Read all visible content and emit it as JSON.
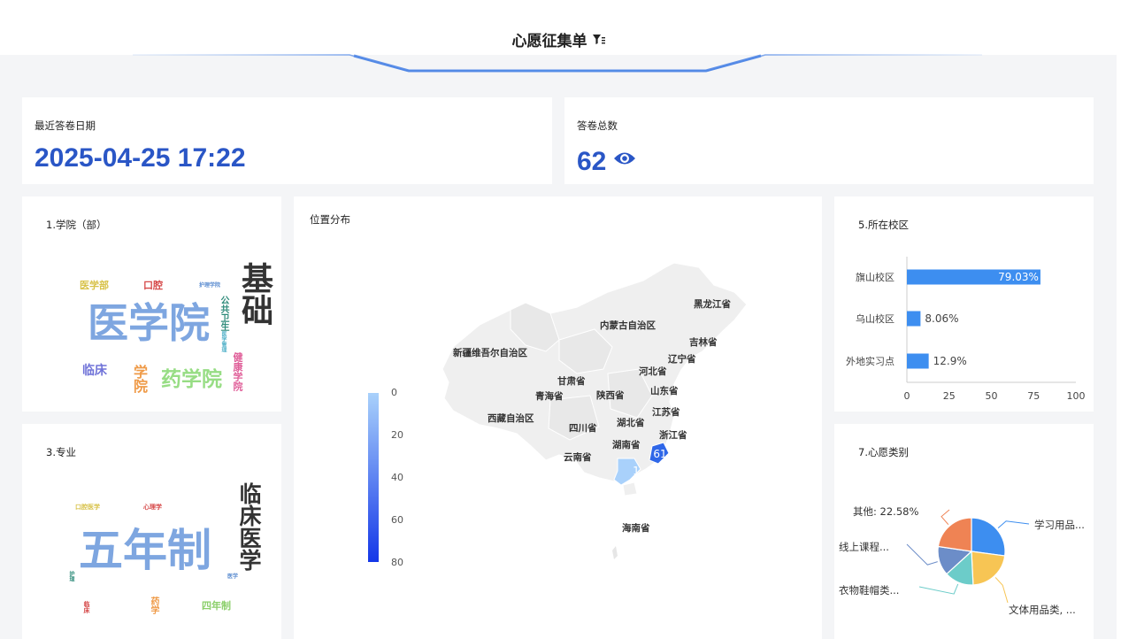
{
  "header": {
    "title": "心愿征集单"
  },
  "kpi_date": {
    "label": "最近答卷日期",
    "value": "2025-04-25 17:22"
  },
  "kpi_count": {
    "label": "答卷总数",
    "value": "62"
  },
  "college": {
    "title": "1.学院（部）",
    "words": [
      "基础",
      "医学院",
      "药学院",
      "学院",
      "临床",
      "医学部",
      "口腔",
      "公共卫生",
      "健康学院",
      "护理学院",
      "医学管理"
    ]
  },
  "major": {
    "title": "3.专业",
    "words": [
      "五年制",
      "临床医学",
      "四年制",
      "药学",
      "临床",
      "口腔医学",
      "心理学",
      "医学",
      "护理"
    ]
  },
  "map": {
    "title": "位置分布",
    "provinces": [
      "黑龙江省",
      "内蒙古自治区",
      "吉林省",
      "新疆维吾尔自治区",
      "辽宁省",
      "甘肃省",
      "河北省",
      "青海省",
      "陕西省",
      "山东省",
      "江苏省",
      "西藏自治区",
      "湖北省",
      "四川省",
      "浙江省",
      "湖南省",
      "云南省",
      "海南省"
    ],
    "values": {
      "guangdong": "1",
      "fujian": "61"
    },
    "legend_ticks": [
      "0",
      "20",
      "40",
      "60",
      "80"
    ]
  },
  "campus": {
    "title": "5.所在校区"
  },
  "wish": {
    "title": "7.心愿类别",
    "labels": [
      "其他: 22.58%",
      "学习用品...",
      "线上课程...",
      "衣物鞋帽类...",
      "文体用品类, ..."
    ]
  },
  "chart_data": [
    {
      "type": "bar",
      "title": "5.所在校区",
      "orientation": "horizontal",
      "categories": [
        "旗山校区",
        "乌山校区",
        "外地实习点"
      ],
      "values": [
        79.03,
        8.06,
        12.9
      ],
      "value_labels": [
        "79.03%",
        "8.06%",
        "12.9%"
      ],
      "xlim": [
        0,
        100
      ],
      "xticks": [
        "0",
        "25",
        "50",
        "75",
        "100"
      ],
      "colors": [
        "#3d8ef0"
      ]
    },
    {
      "type": "pie",
      "title": "7.心愿类别",
      "categories": [
        "学习用品...",
        "文体用品类, ...",
        "衣物鞋帽类...",
        "线上课程...",
        "其他"
      ],
      "values": [
        27,
        22,
        14,
        14,
        22.58
      ],
      "colors": [
        "#3d8ef0",
        "#f7c554",
        "#6cccc9",
        "#6c8dc8",
        "#ef8354"
      ]
    }
  ]
}
